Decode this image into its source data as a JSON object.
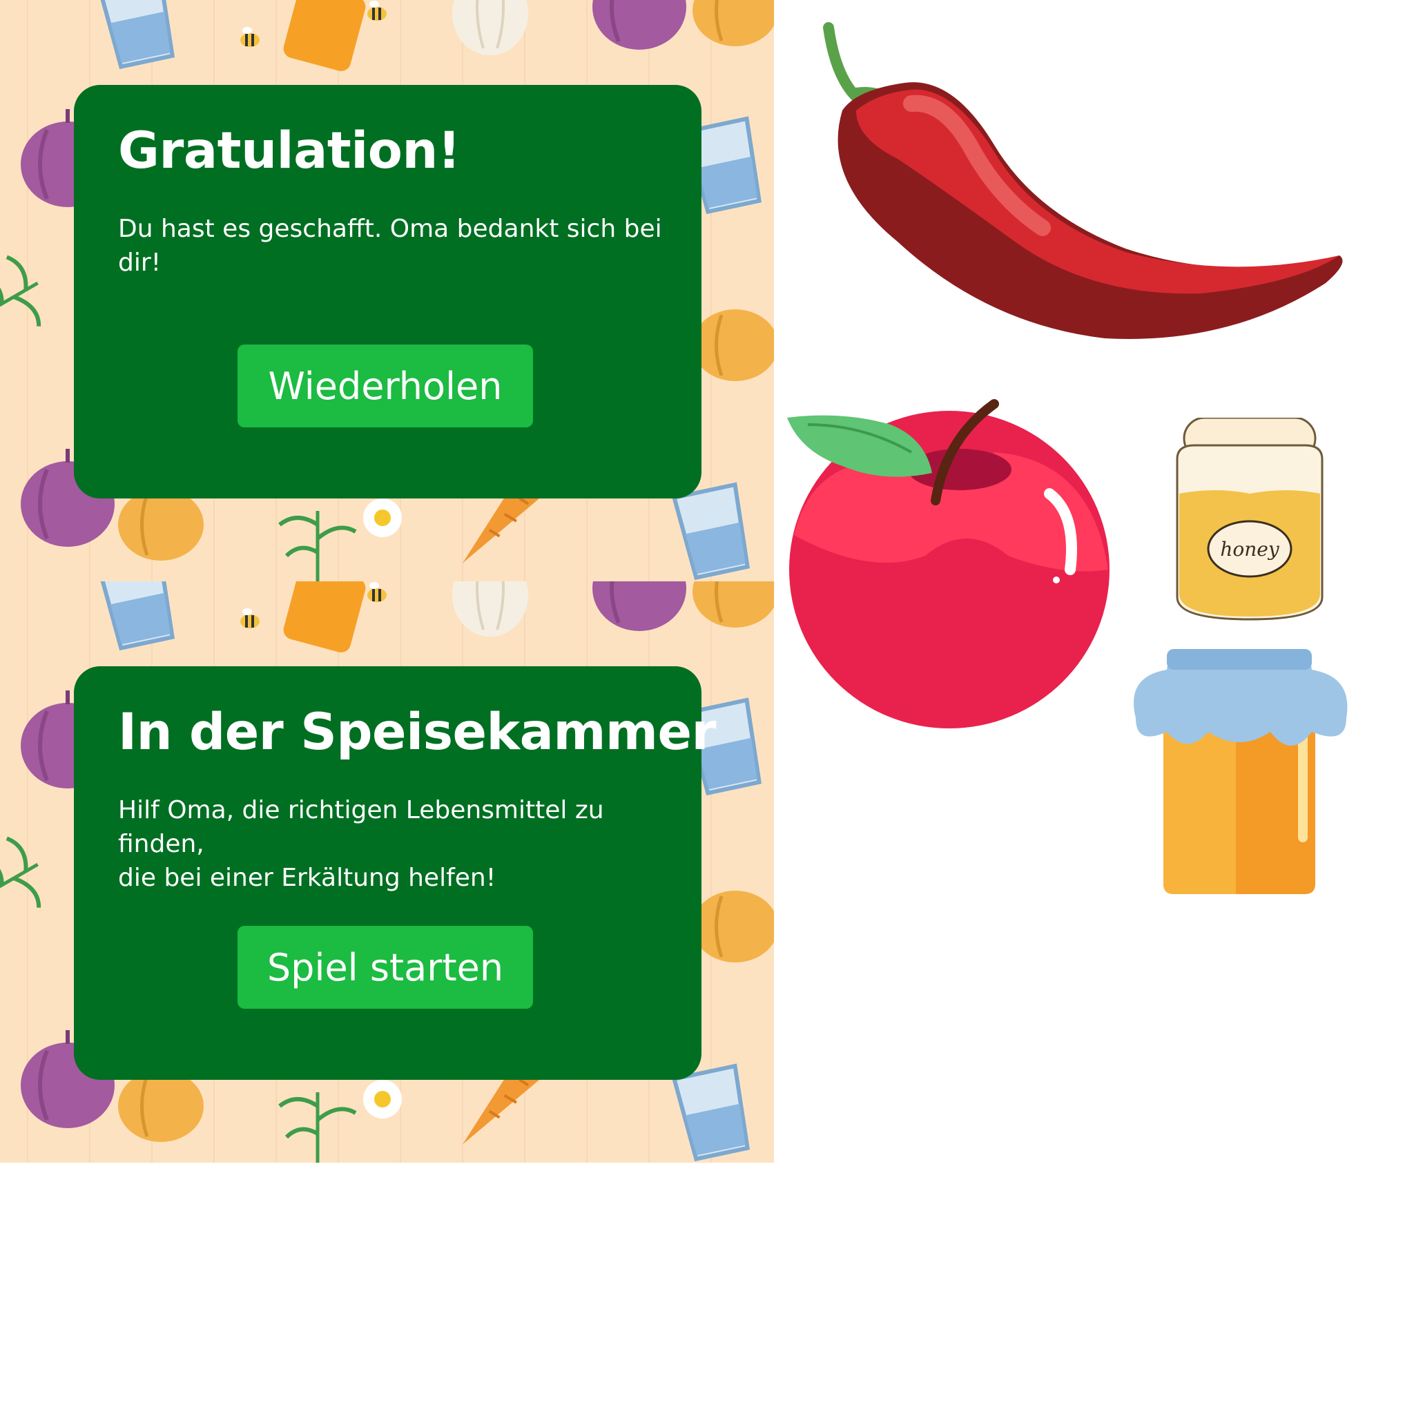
{
  "screens": {
    "success": {
      "title": "Gratulation!",
      "text": "Du hast es geschafft. Oma bedankt sich bei dir!",
      "button_label": "Wiederholen"
    },
    "intro": {
      "title": "In der Speisekammer",
      "text": "Hilf Oma, die richtigen Lebensmittel zu finden,\ndie bei einer Erkältung helfen!",
      "button_label": "Spiel starten"
    }
  },
  "assets": [
    {
      "name": "chili-icon"
    },
    {
      "name": "apple-icon"
    },
    {
      "name": "honey-jar-icon",
      "label": "honey"
    },
    {
      "name": "jam-jar-icon"
    }
  ],
  "colors": {
    "background": "#fde2c2",
    "card": "#006f22",
    "button": "#1cbb42",
    "text": "#ffffff"
  }
}
